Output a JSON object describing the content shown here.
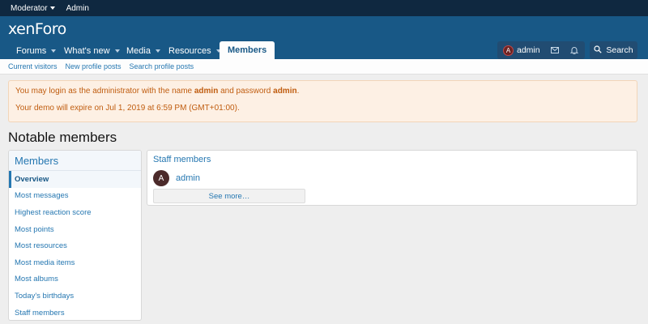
{
  "topbar": {
    "moderator": "Moderator",
    "admin": "Admin"
  },
  "header": {
    "logo_part1": "xen",
    "logo_part2": "Foro"
  },
  "nav": {
    "tabs": [
      {
        "label": "Forums"
      },
      {
        "label": "What's new"
      },
      {
        "label": "Media"
      },
      {
        "label": "Resources"
      },
      {
        "label": "Members"
      }
    ],
    "user": {
      "avatar_letter": "A",
      "name": "admin"
    },
    "search_label": "Search"
  },
  "subnav": {
    "items": [
      "Current visitors",
      "New profile posts",
      "Search profile posts"
    ]
  },
  "notice": {
    "line1_pre": "You may login as the administrator with the name ",
    "line1_name": "admin",
    "line1_mid": " and password ",
    "line1_pass": "admin",
    "line1_end": ".",
    "line2": "Your demo will expire on Jul 1, 2019 at 6:59 PM (GMT+01:00)."
  },
  "page_title": "Notable members",
  "sidebar": {
    "title": "Members",
    "items": [
      "Overview",
      "Most messages",
      "Highest reaction score",
      "Most points",
      "Most resources",
      "Most media items",
      "Most albums",
      "Today's birthdays",
      "Staff members"
    ]
  },
  "main": {
    "section_title": "Staff members",
    "member": {
      "avatar_letter": "A",
      "name": "admin"
    },
    "see_more": "See more…"
  },
  "colors": {
    "header": "#185886",
    "topbar": "#0f2840",
    "link": "#2577b1",
    "notice_text": "#c05d10",
    "notice_bg": "#fdf0e4"
  }
}
